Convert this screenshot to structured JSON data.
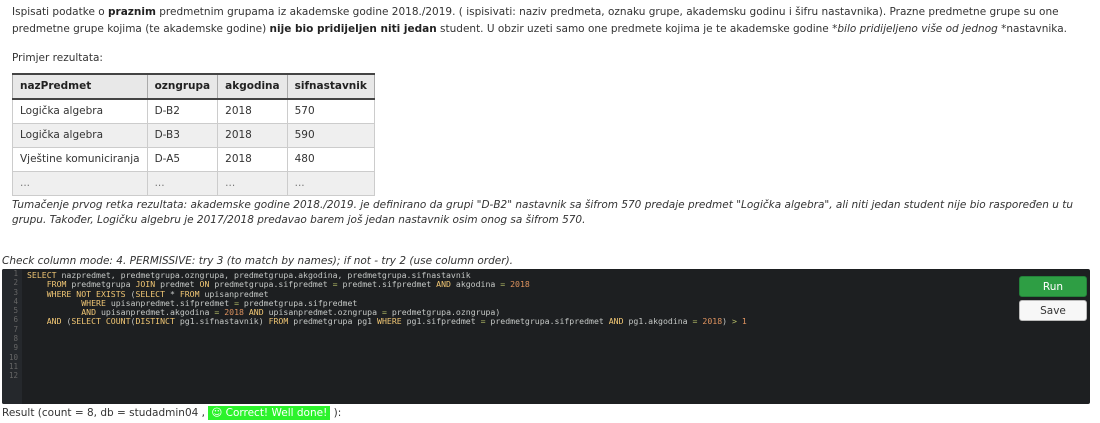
{
  "task": {
    "p1_a": "Ispisati podatke o ",
    "p1_b": "praznim",
    "p1_c": " predmetnim grupama iz akademske godine 2018./2019. ( ispisivati: naziv predmeta, oznaku grupe, akademsku godinu i šifru nastavnika). Prazne predmetne grupe su one predmetne grupe kojima (te akademske godine) ",
    "p1_d": "nije bio pridijeljen niti jedan",
    "p1_e": " student. U obzir uzeti samo one predmete kojima je te akademske godine *",
    "p1_f": "bilo pridijeljeno više od jednog",
    "p1_g": " *nastavnika.",
    "example_label": "Primjer rezultata:",
    "interpretation": "Tumačenje prvog retka rezultata: akademske godine 2018./2019. je definirano da grupi \"D-B2\" nastavnik sa šifrom 570 predaje predmet \"Logička algebra\", ali niti jedan student nije bio raspoređen u tu grupu. Također, Logičku algebru je 2017/2018 predavao barem još jedan nastavnik osim onog sa šifrom 570."
  },
  "example_table": {
    "headers": [
      "nazPredmet",
      "ozngrupa",
      "akgodina",
      "sifnastavnik"
    ],
    "rows": [
      [
        "Logička algebra",
        "D-B2",
        "2018",
        "570"
      ],
      [
        "Logička algebra",
        "D-B3",
        "2018",
        "590"
      ],
      [
        "Vještine komuniciranja",
        "D-A5",
        "2018",
        "480"
      ],
      [
        "...",
        "...",
        "...",
        "..."
      ]
    ]
  },
  "check_mode": "Check column mode: 4. PERMISSIVE: try 3 (to match by names); if not - try 2 (use column order).",
  "editor": {
    "line_numbers": [
      "1",
      "2",
      "3",
      "4",
      "5",
      "6",
      "7",
      "8",
      "9",
      "10",
      "11",
      "12"
    ],
    "lines": [
      [
        [
          "kw",
          "SELECT"
        ],
        [
          "id",
          " nazpredmet, predmetgrupa.ozngrupa, predmetgrupa.akgodina, predmetgrupa.sifnastavnik"
        ]
      ],
      [
        [
          "id",
          "    "
        ],
        [
          "kw",
          "FROM"
        ],
        [
          "id",
          " predmetgrupa "
        ],
        [
          "kw",
          "JOIN"
        ],
        [
          "id",
          " predmet "
        ],
        [
          "kw",
          "ON"
        ],
        [
          "id",
          " predmetgrupa.sifpredmet "
        ],
        [
          "op",
          "="
        ],
        [
          "id",
          " predmet.sifpredmet "
        ],
        [
          "kw",
          "AND"
        ],
        [
          "id",
          " akgodina "
        ],
        [
          "op",
          "="
        ],
        [
          "num",
          " 2018"
        ]
      ],
      [
        [
          "id",
          "    "
        ],
        [
          "kw",
          "WHERE NOT EXISTS"
        ],
        [
          "id",
          " ("
        ],
        [
          "kw",
          "SELECT"
        ],
        [
          "id",
          " * "
        ],
        [
          "kw",
          "FROM"
        ],
        [
          "id",
          " upisanpredmet"
        ]
      ],
      [
        [
          "id",
          "           "
        ],
        [
          "kw",
          "WHERE"
        ],
        [
          "id",
          " upisanpredmet.sifpredmet "
        ],
        [
          "op",
          "="
        ],
        [
          "id",
          " predmetgrupa.sifpredmet"
        ]
      ],
      [
        [
          "id",
          "           "
        ],
        [
          "kw",
          "AND"
        ],
        [
          "id",
          " upisanpredmet.akgodina "
        ],
        [
          "op",
          "="
        ],
        [
          "num",
          " 2018"
        ],
        [
          "id",
          " "
        ],
        [
          "kw",
          "AND"
        ],
        [
          "id",
          " upisanpredmet.ozngrupa "
        ],
        [
          "op",
          "="
        ],
        [
          "id",
          " predmetgrupa.ozngrupa)"
        ]
      ],
      [
        [
          "id",
          "    "
        ],
        [
          "kw",
          "AND"
        ],
        [
          "id",
          " ("
        ],
        [
          "kw",
          "SELECT COUNT"
        ],
        [
          "id",
          "("
        ],
        [
          "kw",
          "DISTINCT"
        ],
        [
          "id",
          " pg1.sifnastavnik) "
        ],
        [
          "kw",
          "FROM"
        ],
        [
          "id",
          " predmetgrupa pg1 "
        ],
        [
          "kw",
          "WHERE"
        ],
        [
          "id",
          " pg1.sifpredmet "
        ],
        [
          "op",
          "="
        ],
        [
          "id",
          " predmetgrupa.sifpredmet "
        ],
        [
          "kw",
          "AND"
        ],
        [
          "id",
          " pg1.akgodina "
        ],
        [
          "op",
          "="
        ],
        [
          "num",
          " 2018"
        ],
        [
          "id",
          ") "
        ],
        [
          "op",
          ">"
        ],
        [
          "num",
          " 1"
        ]
      ],
      [],
      [],
      [],
      [],
      [],
      []
    ]
  },
  "buttons": {
    "run_label": "Run",
    "save_label": "Save"
  },
  "result": {
    "prefix": "Result (count = 8, db = studadmin04 , ",
    "badge": "☺ Correct! Well done!",
    "suffix": " ):"
  },
  "colors": {
    "run_button": "#2e9e44",
    "badge": "#2cf32c",
    "editor_bg": "#1d1f21",
    "keyword": "#f0c674",
    "number": "#de935f"
  }
}
